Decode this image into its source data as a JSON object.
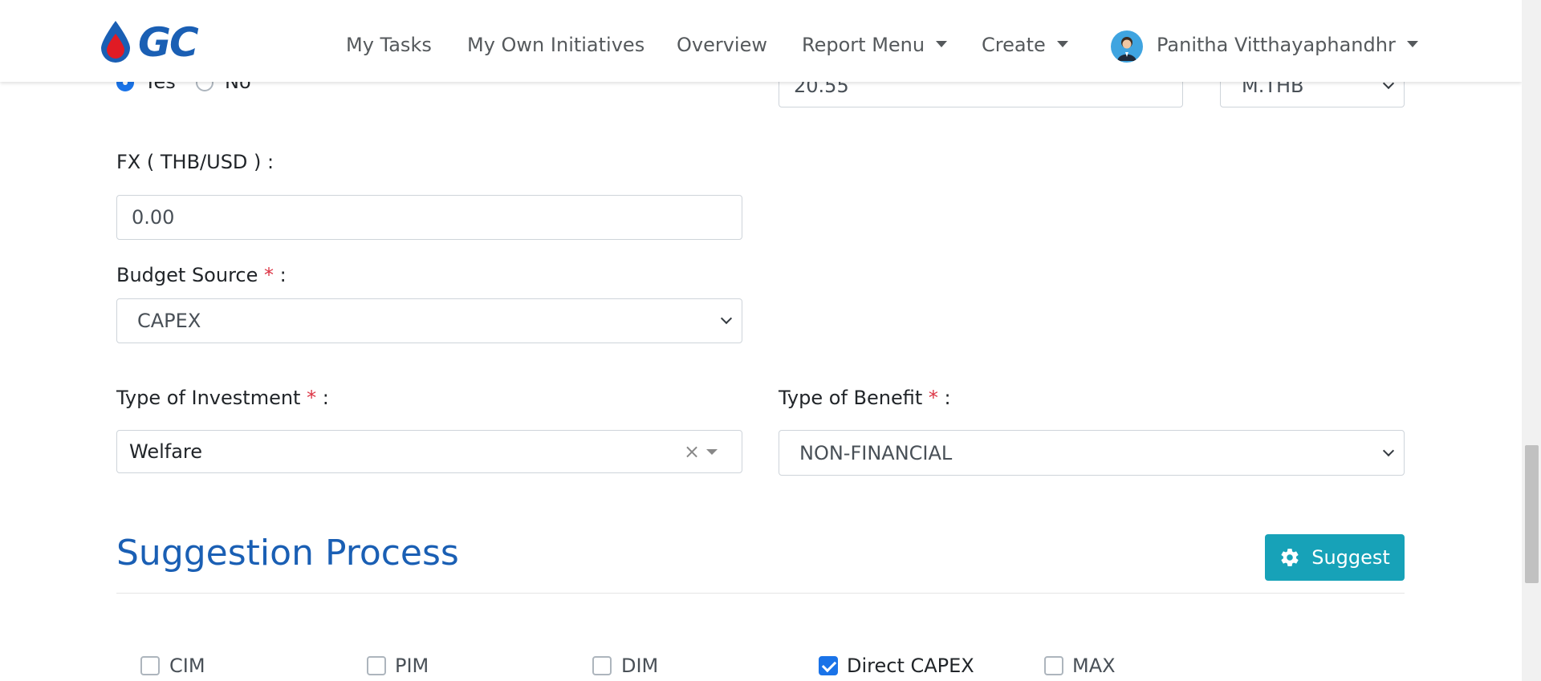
{
  "nav": {
    "logo_text": "GC",
    "items": [
      "My Tasks",
      "My Own Initiatives",
      "Overview",
      "Report Menu",
      "Create"
    ],
    "user_name": "Panitha Vitthayaphandhr"
  },
  "form": {
    "radio_yes": "Yes",
    "radio_no": "No",
    "amount_value": "20.55",
    "amount_unit": "M.THB",
    "fx_label": "FX ( THB/USD ) :",
    "fx_value": "0.00",
    "budget_source_label": "Budget Source",
    "budget_source_value": "CAPEX",
    "type_investment_label": "Type of Investment",
    "type_investment_value": "Welfare",
    "type_benefit_label": "Type of Benefit",
    "type_benefit_value": "NON-FINANCIAL",
    "required_mark": "*",
    "colon": ":"
  },
  "suggestion": {
    "title": "Suggestion Process",
    "button_label": "Suggest",
    "options": [
      {
        "label": "CIM",
        "checked": false
      },
      {
        "label": "PIM",
        "checked": false
      },
      {
        "label": "DIM",
        "checked": false
      },
      {
        "label": "Direct CAPEX",
        "checked": true
      },
      {
        "label": "MAX",
        "checked": false
      }
    ]
  },
  "colors": {
    "brand_blue": "#1a5fb4",
    "accent_teal": "#17a2b8",
    "check_blue": "#1a73e8",
    "required_red": "#dc3545"
  }
}
